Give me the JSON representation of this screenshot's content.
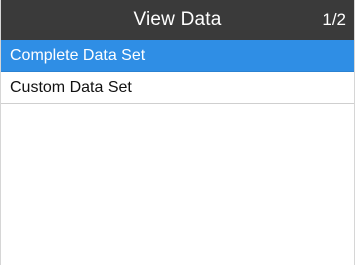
{
  "header": {
    "title": "View Data",
    "page_indicator": "1/2"
  },
  "menu": {
    "items": [
      {
        "label": "Complete Data Set",
        "selected": true
      },
      {
        "label": "Custom Data Set",
        "selected": false
      }
    ]
  },
  "colors": {
    "header_bg": "#3a3a3a",
    "selection_bg": "#2f8ee5",
    "background": "#ffffff"
  }
}
